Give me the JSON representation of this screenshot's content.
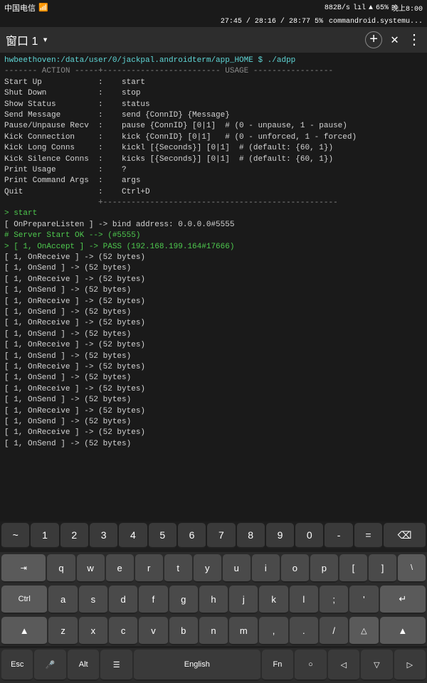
{
  "statusBar": {
    "carrier": "中国电信",
    "speed": "882B/s",
    "signal": "ił",
    "wifi": "奈",
    "battery": "65%",
    "time": "晚上8:00",
    "time2": "27:45 / 28:16 / 28:77",
    "progress": "5%",
    "subtitle": "commandroid.systemu..."
  },
  "titleBar": {
    "title": "窗口 1",
    "chevron": "▾"
  },
  "terminal": {
    "lines": [
      "hwbeethoven:/data/user/0/jackpal.androidterm/app_HOME $ ./adpp",
      "------- ACTION -----+------------------------- USAGE -----------------",
      "Start Up            :    start",
      "Shut Down           :    stop",
      "Show Status         :    status",
      "Send Message        :    send {ConnID} {Message}",
      "Pause/Unpause Recv  :    pause {ConnID} [0|1]  # (0 - unpause, 1 - pause)",
      "Kick Connection     :    kick {ConnID} [0|1]   # (0 - unforced, 1 - forced)",
      "Kick Long Conns     :    kickl [{Seconds}] [0|1]  # (default: {60, 1})",
      "Kick Silence Conns  :    kicks [{Seconds}] [0|1]  # (default: {60, 1})",
      "Print Usage         :    ?",
      "Print Command Args  :    args",
      "Quit                :    Ctrl+D",
      "                    +--------------------------------------------------",
      "> start",
      "[ OnPrepareListen ] -> bind address: 0.0.0.0#5555",
      "# Server Start OK --> (#5555)",
      "> [ 1, OnAccept ] -> PASS (192.168.199.164#17666)",
      "[ 1, OnReceive ] -> (52 bytes)",
      "[ 1, OnSend ] -> (52 bytes)",
      "[ 1, OnReceive ] -> (52 bytes)",
      "[ 1, OnSend ] -> (52 bytes)",
      "[ 1, OnReceive ] -> (52 bytes)",
      "[ 1, OnSend ] -> (52 bytes)",
      "[ 1, OnReceive ] -> (52 bytes)",
      "[ 1, OnSend ] -> (52 bytes)",
      "[ 1, OnReceive ] -> (52 bytes)",
      "[ 1, OnSend ] -> (52 bytes)",
      "[ 1, OnReceive ] -> (52 bytes)",
      "[ 1, OnSend ] -> (52 bytes)",
      "[ 1, OnReceive ] -> (52 bytes)",
      "[ 1, OnSend ] -> (52 bytes)",
      "[ 1, OnReceive ] -> (52 bytes)",
      "[ 1, OnSend ] -> (52 bytes)",
      "[ 1, OnReceive ] -> (52 bytes)",
      "[ 1, OnSend ] -> (52 bytes)"
    ]
  },
  "keyboard": {
    "numRow": [
      "~",
      "1",
      "2",
      "3",
      "4",
      "5",
      "6",
      "7",
      "8",
      "9",
      "0",
      "-",
      "=",
      "⌫"
    ],
    "row1": [
      "⇥",
      "q",
      "w",
      "e",
      "r",
      "t",
      "y",
      "u",
      "i",
      "o",
      "p",
      "[",
      "]",
      "\\"
    ],
    "row2": [
      "Ctrl",
      "a",
      "s",
      "d",
      "f",
      "g",
      "h",
      "j",
      "k",
      "l",
      ";",
      "'",
      "↵"
    ],
    "row3": [
      "▲",
      "z",
      "x",
      "c",
      "v",
      "b",
      "n",
      "m",
      ",",
      ".",
      "/",
      "△",
      "▲"
    ],
    "bottomRow": [
      "Esc",
      "🎤",
      "Alt",
      "☰",
      "English",
      "Fn",
      "○",
      "◁",
      "▽",
      "▷"
    ]
  }
}
